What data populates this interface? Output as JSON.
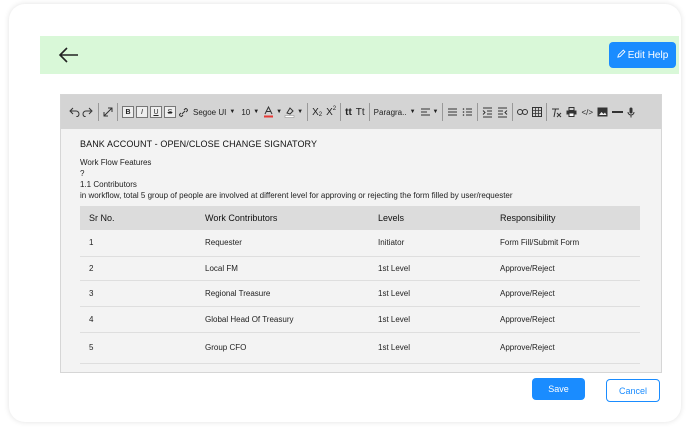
{
  "header": {
    "edit_help_label": "Edit Help"
  },
  "toolbar": {
    "font_name": "Segoe UI",
    "font_size": "10",
    "paragraph": "Paragra.."
  },
  "document": {
    "title": "BANK ACCOUNT - OPEN/CLOSE CHANGE SIGNATORY",
    "line1": "Work Flow Features",
    "line2": "?",
    "line3": "1.1 Contributors",
    "line4": "in workflow, total 5 group of people are involved at different level for approving or rejecting the form filled by user/requester"
  },
  "table": {
    "headers": [
      "Sr No.",
      "Work Contributors",
      "Levels",
      "Responsibility"
    ],
    "rows": [
      [
        "1",
        "Requester",
        "Initiator",
        "Form Fill/Submit Form"
      ],
      [
        "2",
        "Local FM",
        "1st Level",
        "Approve/Reject"
      ],
      [
        "3",
        "Regional Treasure",
        "1st Level",
        "Approve/Reject"
      ],
      [
        "4",
        "Global Head Of Treasury",
        "1st Level",
        "Approve/Reject"
      ],
      [
        "5",
        "Group CFO",
        "1st Level",
        "Approve/Reject"
      ]
    ]
  },
  "actions": {
    "save_label": "Save",
    "cancel_label": "Cancel"
  },
  "colors": {
    "accent": "#1a8cff",
    "header_bg": "#d9f8d8",
    "toolbar_bg": "#d4d4d4"
  }
}
